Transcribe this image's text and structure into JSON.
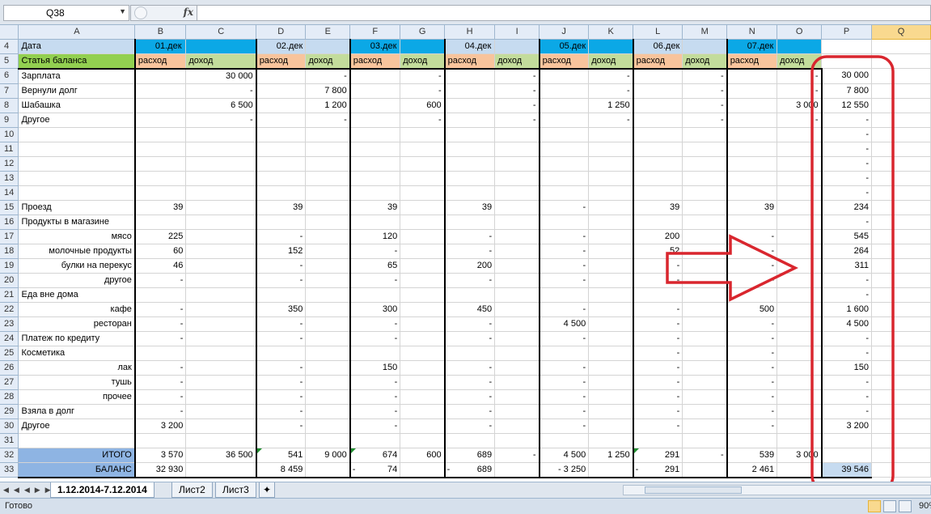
{
  "formula_bar": {
    "cell_ref": "Q38",
    "fx_label": "fx",
    "formula": ""
  },
  "columns": [
    "A",
    "B",
    "C",
    "D",
    "E",
    "F",
    "G",
    "H",
    "I",
    "J",
    "K",
    "L",
    "M",
    "N",
    "O",
    "P",
    "Q"
  ],
  "rows": [
    {
      "n": "4",
      "A": "Дата",
      "B": "01.дек",
      "D": "02.дек",
      "F": "03.дек",
      "H": "04.дек",
      "J": "05.дек",
      "L": "06.дек",
      "N": "07.дек"
    },
    {
      "n": "5",
      "A": "Статья баланса",
      "B": "расход",
      "C": "доход",
      "D": "расход",
      "E": "доход",
      "F": "расход",
      "G": "доход",
      "H": "расход",
      "I": "доход",
      "J": "расход",
      "K": "доход",
      "L": "расход",
      "M": "доход",
      "N": "расход",
      "O": "доход"
    },
    {
      "n": "6",
      "A": "Зарплата",
      "C": "30 000",
      "E": "-",
      "G": "-",
      "I": "-",
      "K": "-",
      "M": "-",
      "O": "-",
      "P": "30 000"
    },
    {
      "n": "7",
      "A": "Вернули долг",
      "C": "-",
      "E": "7 800",
      "G": "-",
      "I": "-",
      "K": "-",
      "M": "-",
      "O": "-",
      "P": "7 800"
    },
    {
      "n": "8",
      "A": "Шабашка",
      "C": "6 500",
      "E": "1 200",
      "G": "600",
      "I": "-",
      "K": "1 250",
      "M": "-",
      "O": "3 000",
      "P": "12 550"
    },
    {
      "n": "9",
      "A": "Другое",
      "C": "-",
      "E": "-",
      "G": "-",
      "I": "-",
      "K": "-",
      "M": "-",
      "O": "-",
      "P": "-"
    },
    {
      "n": "10",
      "P": "-"
    },
    {
      "n": "11",
      "P": "-"
    },
    {
      "n": "12",
      "P": "-"
    },
    {
      "n": "13",
      "P": "-"
    },
    {
      "n": "14",
      "P": "-"
    },
    {
      "n": "15",
      "A": "Проезд",
      "B": "39",
      "D": "39",
      "F": "39",
      "H": "39",
      "J": "-",
      "L": "39",
      "N": "39",
      "P": "234"
    },
    {
      "n": "16",
      "A": "Продукты в магазине",
      "P": "-"
    },
    {
      "n": "17",
      "A": "мясо",
      "B": "225",
      "D": "-",
      "F": "120",
      "H": "-",
      "J": "-",
      "L": "200",
      "N": "-",
      "P": "545"
    },
    {
      "n": "18",
      "A": "молочные продукты",
      "B": "60",
      "D": "152",
      "F": "-",
      "H": "-",
      "J": "-",
      "L": "52",
      "N": "-",
      "P": "264"
    },
    {
      "n": "19",
      "A": "булки на перекус",
      "B": "46",
      "D": "-",
      "F": "65",
      "H": "200",
      "J": "-",
      "L": "-",
      "N": "-",
      "P": "311"
    },
    {
      "n": "20",
      "A": "другое",
      "B": "-",
      "D": "-",
      "F": "-",
      "H": "-",
      "J": "-",
      "L": "-",
      "N": "-",
      "P": "-"
    },
    {
      "n": "21",
      "A": "Еда вне дома",
      "P": "-"
    },
    {
      "n": "22",
      "A": "кафе",
      "B": "-",
      "D": "350",
      "F": "300",
      "H": "450",
      "J": "-",
      "L": "-",
      "N": "500",
      "P": "1 600"
    },
    {
      "n": "23",
      "A": "ресторан",
      "B": "-",
      "D": "-",
      "F": "-",
      "H": "-",
      "J": "4 500",
      "L": "-",
      "N": "-",
      "P": "4 500"
    },
    {
      "n": "24",
      "A": "Платеж по кредиту",
      "B": "-",
      "D": "-",
      "F": "-",
      "H": "-",
      "J": "-",
      "L": "-",
      "N": "-",
      "P": "-"
    },
    {
      "n": "25",
      "A": "Косметика",
      "L": "-",
      "N": "-",
      "P": "-"
    },
    {
      "n": "26",
      "A": "лак",
      "B": "-",
      "D": "-",
      "F": "150",
      "H": "-",
      "J": "-",
      "L": "-",
      "N": "-",
      "P": "150"
    },
    {
      "n": "27",
      "A": "тушь",
      "B": "-",
      "D": "-",
      "F": "-",
      "H": "-",
      "J": "-",
      "L": "-",
      "N": "-",
      "P": "-"
    },
    {
      "n": "28",
      "A": "прочее",
      "B": "-",
      "D": "-",
      "F": "-",
      "H": "-",
      "J": "-",
      "L": "-",
      "N": "-",
      "P": "-"
    },
    {
      "n": "29",
      "A": "Взяла в долг",
      "B": "-",
      "D": "-",
      "F": "-",
      "H": "-",
      "J": "-",
      "L": "-",
      "N": "-",
      "P": "-"
    },
    {
      "n": "30",
      "A": "Другое",
      "B": "3 200",
      "D": "-",
      "F": "-",
      "H": "-",
      "J": "-",
      "L": "-",
      "N": "-",
      "P": "3 200"
    },
    {
      "n": "31"
    },
    {
      "n": "32",
      "A": "ИТОГО",
      "B": "3 570",
      "C": "36 500",
      "D": "541",
      "E": "9 000",
      "F": "674",
      "G": "600",
      "H": "689",
      "I": "-",
      "J": "4 500",
      "K": "1 250",
      "L": "291",
      "M": "-",
      "N": "539",
      "O": "3 000"
    },
    {
      "n": "33",
      "A": "БАЛАНС",
      "B": "32 930",
      "D": "8 459",
      "Fpre": "-",
      "F": "74",
      "Hpre": "-",
      "H": "689",
      "J": "- 3 250",
      "Lpre": "-",
      "L": "291",
      "N": "2 461",
      "P": "39 546"
    }
  ],
  "sheet_tabs": [
    {
      "label": "1.12.2014-7.12.2014",
      "active": true
    },
    {
      "label": "Лист2",
      "active": false
    },
    {
      "label": "Лист3",
      "active": false
    }
  ],
  "status": {
    "ready_text": "Готово",
    "zoom": "90"
  },
  "colors": {
    "date_blue": "#0ba8e6",
    "green_header": "#92d050",
    "orange_header": "#f8c49c",
    "annotation_red": "#d9262e",
    "total_blue": "#8eb4e3"
  }
}
